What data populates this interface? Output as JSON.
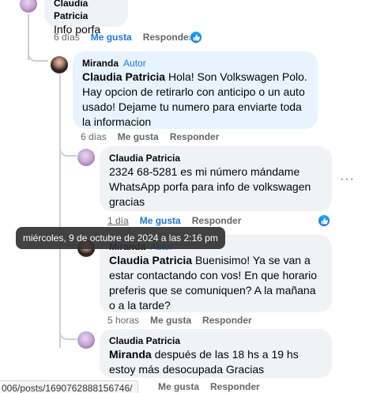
{
  "comments": [
    {
      "author": "Claudia Patricia",
      "text": "Info porfa",
      "time": "6 días",
      "like_label": "Me gusta",
      "reply_label": "Responder",
      "has_reaction": true
    },
    {
      "author": "Miranda",
      "badge": "Autor",
      "mention": "Claudia Patricia",
      "text": "Hola! Son Volkswagen Polo. Hay opcion de retirarlo con anticipo o un auto usado! Dejame tu numero para enviarte toda la informacion",
      "time": "6 días",
      "like_label": "Me gusta",
      "reply_label": "Responder"
    },
    {
      "author": "Claudia Patricia",
      "text": "2324 68-5281 es mi número mándame WhatsApp porfa para info de volkswagen gracias",
      "time": "1 día",
      "like_label": "Me gusta",
      "reply_label": "Responder",
      "has_reaction": true
    },
    {
      "author": "Miranda",
      "badge": "Autor",
      "mention": "Claudia Patricia",
      "text": "Buenisimo! Ya se van a estar contactando con vos! En que horario preferis que se comuniquen? A la mañana o a la tarde?",
      "time": "5 horas",
      "like_label": "Me gusta",
      "reply_label": "Responder"
    },
    {
      "author": "Claudia Patricia",
      "mention": "Miranda",
      "text": "después de las 18 hs a 19 hs estoy más desocupada Gracias",
      "time": "",
      "like_label": "Me gusta",
      "reply_label": "Responder"
    }
  ],
  "tooltip": "miércoles, 9 de octubre de 2024 a las 2:16 pm",
  "more_options": "···",
  "status_url": "006/posts/1690762888156746/"
}
